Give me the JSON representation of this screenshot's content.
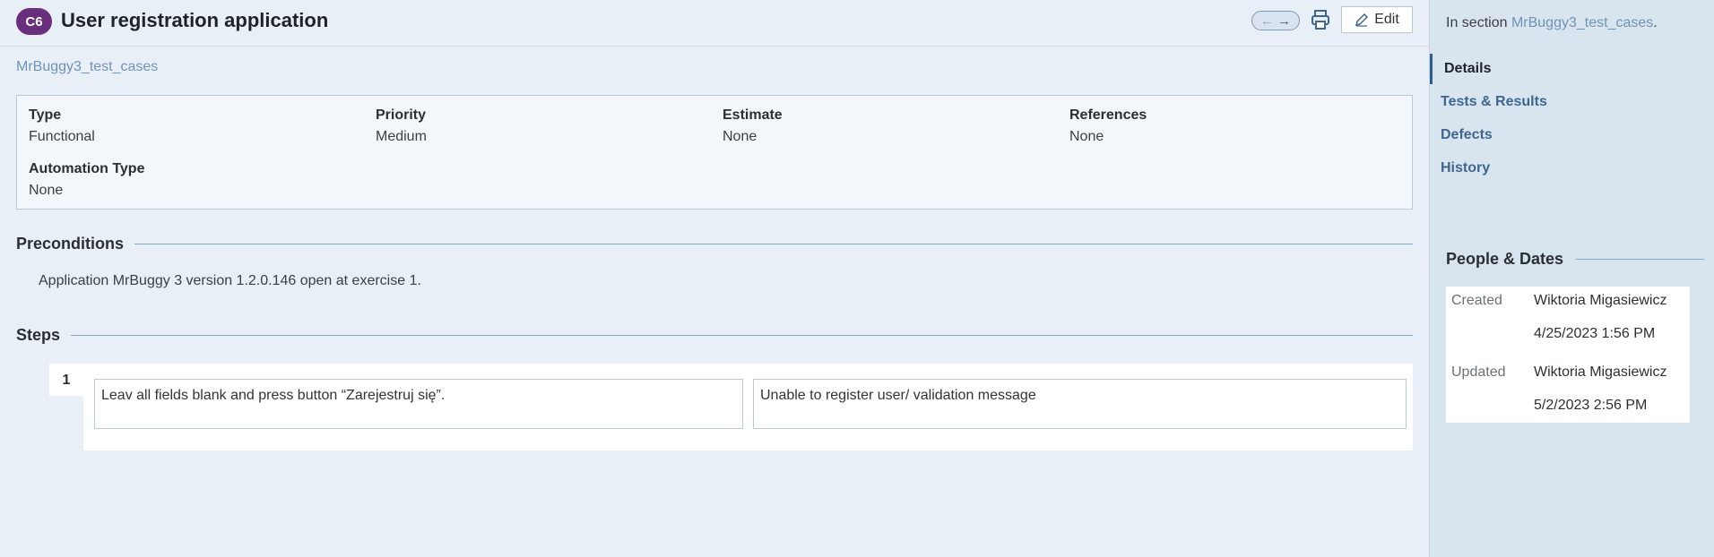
{
  "header": {
    "case_id": "C6",
    "title": "User registration application",
    "edit_label": "Edit",
    "icons": [
      "arrow-left-icon",
      "arrow-right-icon",
      "printer-icon",
      "pencil-icon"
    ]
  },
  "breadcrumb": "MrBuggy3_test_cases",
  "fields": [
    {
      "label": "Type",
      "value": "Functional"
    },
    {
      "label": "Priority",
      "value": "Medium"
    },
    {
      "label": "Estimate",
      "value": "None"
    },
    {
      "label": "References",
      "value": "None"
    },
    {
      "label": "Automation Type",
      "value": "None"
    }
  ],
  "preconditions": {
    "title": "Preconditions",
    "text": "Application MrBuggy 3 version 1.2.0.146 open at exercise 1."
  },
  "steps": {
    "title": "Steps",
    "items": [
      {
        "number": "1",
        "action": "Leav all fields blank and press button “Zarejestruj się”.",
        "expected": "Unable to register user/ validation message"
      }
    ]
  },
  "sidebar": {
    "in_section_prefix": "In section",
    "section_link": "MrBuggy3_test_cases",
    "section_suffix": ".",
    "tabs": [
      "Details",
      "Tests & Results",
      "Defects",
      "History"
    ],
    "active_tab": "Details",
    "people_dates": {
      "title": "People & Dates",
      "created_label": "Created",
      "created_by": "Wiktoria Migasiewicz",
      "created_at": "4/25/2023 1:56 PM",
      "updated_label": "Updated",
      "updated_by": "Wiktoria Migasiewicz",
      "updated_at": "5/2/2023 2:56 PM"
    }
  },
  "colors": {
    "badge": "#6a2f7c",
    "link": "#6f93b7",
    "accent": "#2f5d8c",
    "background": "#e8eff6",
    "sidebar": "#d9e5ee"
  }
}
